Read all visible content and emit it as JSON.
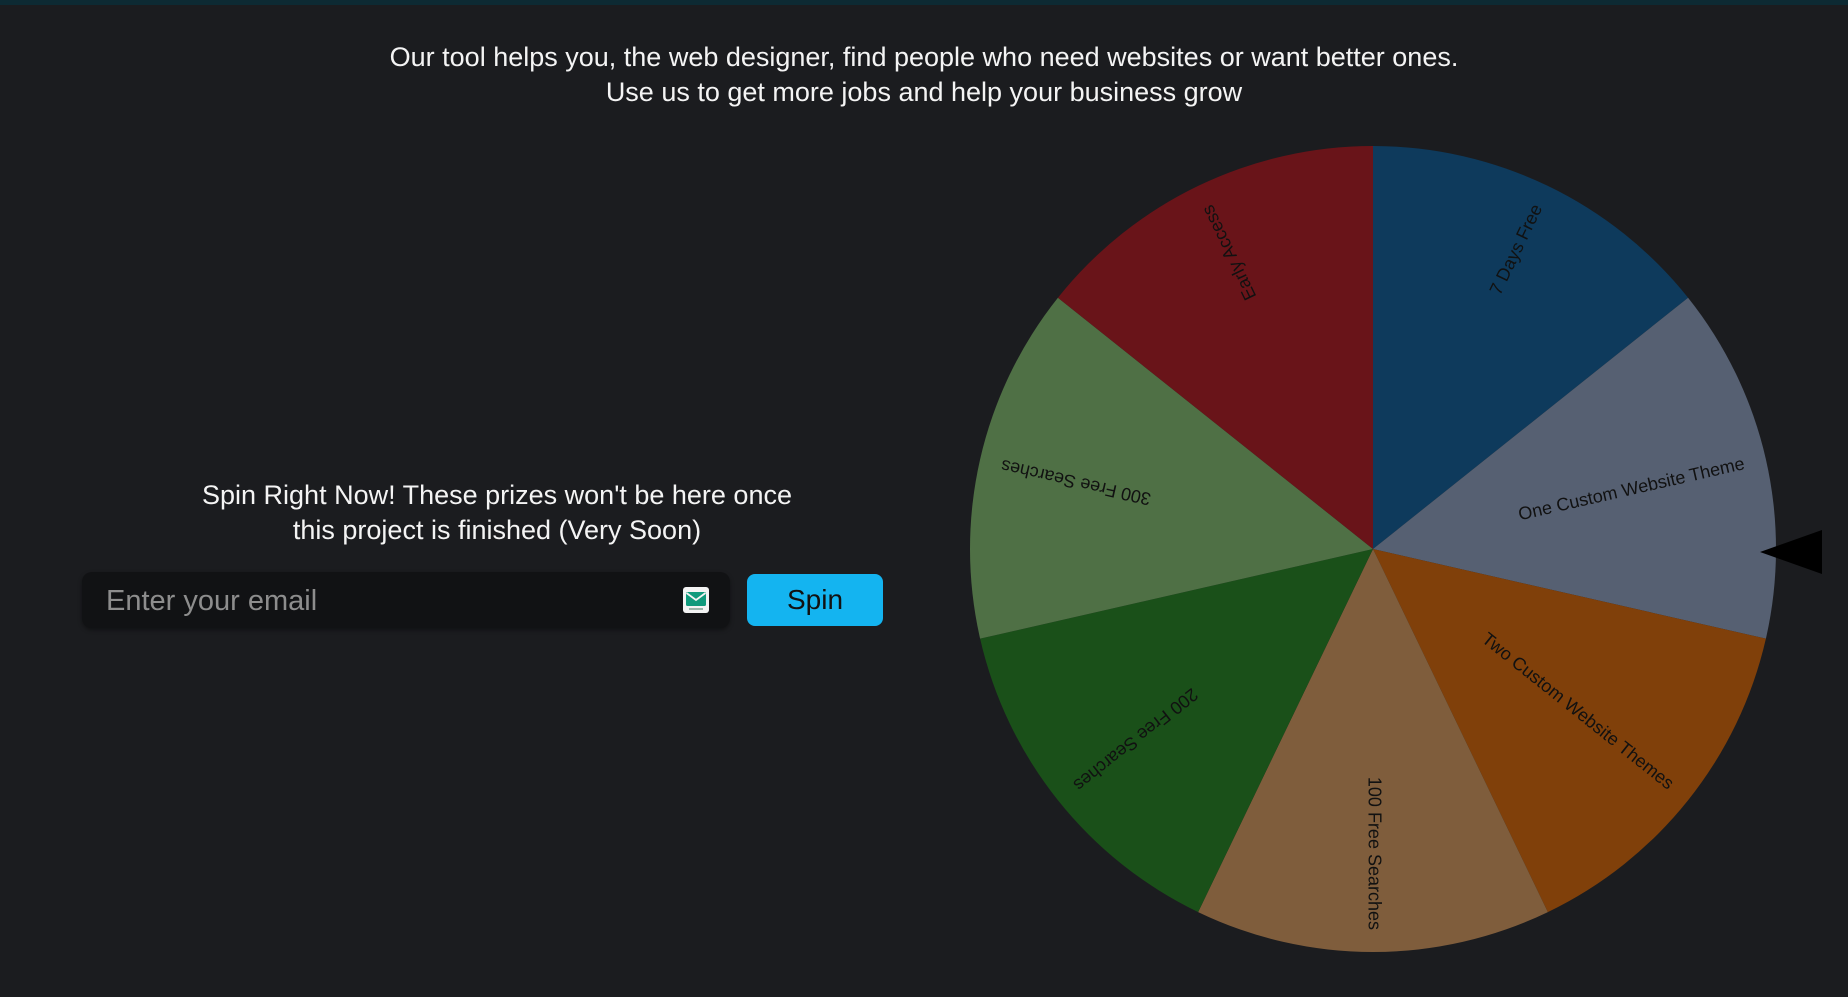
{
  "header": {
    "line1": "Our tool helps you, the web designer, find people who need websites or want better ones.",
    "line2": "Use us to get more jobs and help your business grow"
  },
  "promo": {
    "line1": "Spin Right Now! These prizes won't be here once",
    "line2": "this project is finished (Very Soon)",
    "email_placeholder": "Enter your email",
    "email_value": "",
    "spin_label": "Spin",
    "spin_color": "#14b4f0",
    "email_icon": "mail-icon"
  },
  "wheel": {
    "pointer_icon": "pointer-arrow-icon",
    "segments": [
      {
        "label": "7 Days Free",
        "color": "#0e3a5c"
      },
      {
        "label": "One Custom Website Theme",
        "color": "#566072"
      },
      {
        "label": "Two Custom Website Themes",
        "color": "#80400a"
      },
      {
        "label": "100 Free Searches",
        "color": "#7f5d3c"
      },
      {
        "label": "200 Free Searches",
        "color": "#1a5019"
      },
      {
        "label": "300 Free Searches",
        "color": "#4f7045"
      },
      {
        "label": "Early Access",
        "color": "#691419"
      }
    ]
  }
}
